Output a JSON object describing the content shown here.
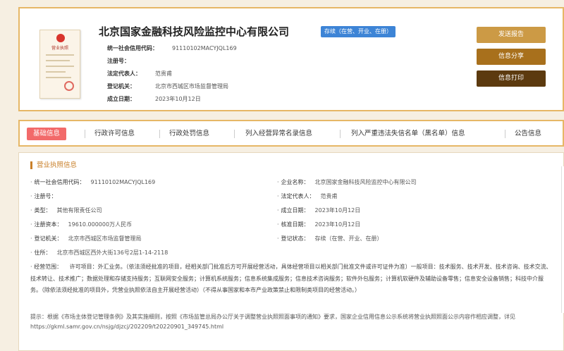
{
  "company": {
    "name": "北京国家金融科技风险监控中心有限公司",
    "status": "存续（在营、开业、在册）",
    "summary": [
      {
        "label": "统一社会信用代码：",
        "value": "91110102MACYJQL169"
      },
      {
        "label": "注册号：",
        "value": ""
      },
      {
        "label": "法定代表人：",
        "value": "范贵甫"
      },
      {
        "label": "登记机关：",
        "value": "北京市西城区市场监督管理局"
      },
      {
        "label": "成立日期：",
        "value": "2023年10月12日"
      }
    ],
    "license_title": "营业执照"
  },
  "actions": {
    "report": "发送报告",
    "share": "信息分享",
    "print": "信息打印"
  },
  "tabs": [
    {
      "label": "基础信息",
      "active": true
    },
    {
      "label": "行政许可信息"
    },
    {
      "label": "行政处罚信息"
    },
    {
      "label": "列入经营异常名录信息"
    },
    {
      "label": "列入严重违法失信名单（黑名单）信息"
    },
    {
      "label": "公告信息"
    }
  ],
  "section": {
    "title": "营业执照信息",
    "left": [
      {
        "k": "统一社会信用代码：",
        "v": "91110102MACYJQL169"
      },
      {
        "k": "注册号：",
        "v": ""
      },
      {
        "k": "类型：",
        "v": "其他有限责任公司"
      },
      {
        "k": "注册资本：",
        "v": "19610.000000万人民币"
      },
      {
        "k": "登记机关：",
        "v": "北京市西城区市场监督管理局"
      },
      {
        "k": "住所：",
        "v": "北京市西城区西外大街136号2层1-14-2118"
      }
    ],
    "right": [
      {
        "k": "企业名称：",
        "v": "北京国家金融科技风险监控中心有限公司"
      },
      {
        "k": "法定代表人：",
        "v": "范贵甫"
      },
      {
        "k": "成立日期：",
        "v": "2023年10月12日"
      },
      {
        "k": "核准日期：",
        "v": "2023年10月12日"
      },
      {
        "k": "登记状态：",
        "v": "存续（在营、开业、在册）"
      }
    ],
    "scope_label": "经营范围：",
    "scope_text": "许可项目：外汇业务。（依法须经批准的项目，经相关部门批准后方可开展经营活动，具体经营项目以相关部门批准文件或许可证件为准）一般项目：技术服务、技术开发、技术咨询、技术交流、技术转让、技术推广；数据处理和存储支持服务；互联网安全服务；计算机系统服务；信息系统集成服务；信息技术咨询服务；软件外包服务；计算机软硬件及辅助设备零售；信息安全设备销售；科技中介服务。（除依法须经批准的项目外，凭营业执照依法自主开展经营活动）（不得从事国家和本市产业政策禁止和限制类项目的经营活动。）",
    "tip": "提示：根据《市场主体登记管理条例》及其实施细则，按照《市场监管总局办公厅关于调整营业执照照面事项的通知》要求，国家企业信用信息公示系统将营业执照照面公示内容作相应调整，详见https://gkml.samr.gov.cn/nsjg/djzcj/202209/t20220901_349745.html"
  }
}
